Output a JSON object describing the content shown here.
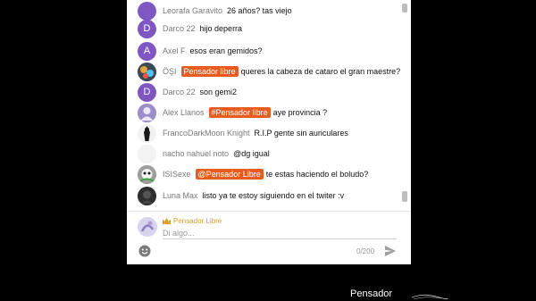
{
  "messages": [
    {
      "author": "Leorafa Garavito",
      "tag": "",
      "text": "26 años? tas viejo",
      "avatar_letter": "",
      "avatar_color": "#7e57c2"
    },
    {
      "author": "Darco 22",
      "tag": "",
      "text": "hijo deperra",
      "avatar_letter": "D",
      "avatar_color": "#7e57c2"
    },
    {
      "author": "Axel F",
      "tag": "",
      "text": "esos eran gemidos?",
      "avatar_letter": "A",
      "avatar_color": "#7e57c2"
    },
    {
      "author": "ÖŞI",
      "tag": "Pensador libre",
      "text": "queres la cabeza de cataro el gran maestre?",
      "avatar_letter": "",
      "avatar_color": "#37474f"
    },
    {
      "author": "Darco 22",
      "tag": "",
      "text": "son gemi2",
      "avatar_letter": "D",
      "avatar_color": "#7e57c2"
    },
    {
      "author": "Alex Llanos",
      "tag": "#Pensador libre",
      "text": "aye provincia ?",
      "avatar_letter": "",
      "avatar_color": "#9575cd"
    },
    {
      "author": "FrancoDarkMoon Knight",
      "tag": "",
      "text": "R.I.P gente sin auriculares",
      "avatar_letter": "",
      "avatar_color": "#222222"
    },
    {
      "author": "nacho nahuel noto",
      "tag": "",
      "text": "@dg igual",
      "avatar_letter": "",
      "avatar_color": "#eeeeee"
    },
    {
      "author": "ISISexe",
      "tag": "@Pensador Libre",
      "text": "te estas haciendo el boludo?",
      "avatar_letter": "",
      "avatar_color": "#8d8d8d"
    },
    {
      "author": "Luna Max",
      "tag": "",
      "text": "listo ya te estoy siguiendo en el twiter :v",
      "avatar_letter": "",
      "avatar_color": "#2b2b2b"
    }
  ],
  "composer": {
    "name": "Pensador Libre",
    "placeholder": "Di algo...",
    "char_count": "0/200"
  },
  "watermark": "Pensador",
  "colors": {
    "accent_tag": "#e85d1f",
    "owner_name": "#d7a12f"
  }
}
